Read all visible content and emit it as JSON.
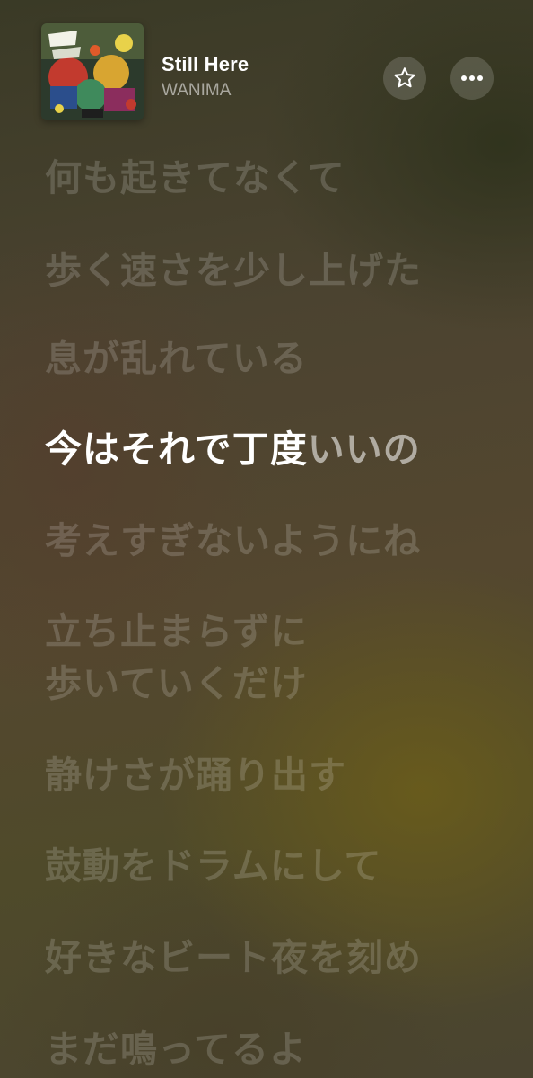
{
  "now_playing": {
    "title": "Still Here",
    "artist": "WANIMA",
    "artwork_icon": "album-artwork"
  },
  "actions": {
    "favorite_icon": "star-icon",
    "more_icon": "ellipsis-icon"
  },
  "lyrics": {
    "lines": [
      {
        "text": "何も起きてなくて"
      },
      {
        "text": "歩く速さを少し上げた"
      },
      {
        "text": "息が乱れている"
      },
      {
        "sung": "今はそれで丁度",
        "unsung": "いいの"
      },
      {
        "text": "考えすぎないようにね"
      },
      {
        "text": "立ち止まらずに",
        "text2": "歩いていくだけ"
      },
      {
        "text": "静けさが踊り出す"
      },
      {
        "text": "鼓動をドラムにして"
      },
      {
        "text": "好きなビート夜を刻め"
      },
      {
        "text": "まだ鳴ってるよ"
      }
    ]
  },
  "colors": {
    "active_lyric": "#ffffff",
    "inactive_lyric": "rgba(255,255,255,0.17)"
  }
}
